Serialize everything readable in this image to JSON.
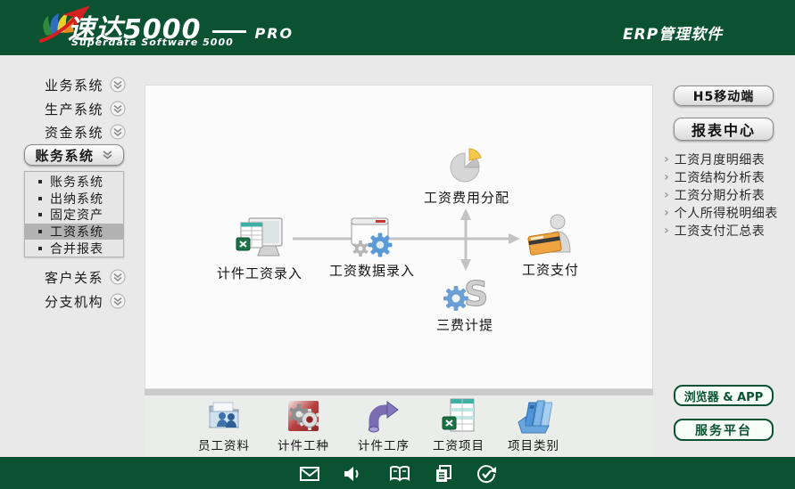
{
  "header": {
    "product_name": "速达5000",
    "edition": "PRO",
    "subtitle": "Superdata Software 5000",
    "tagline": "ERP管理软件"
  },
  "sidebar": {
    "items": [
      {
        "label": "业务系统"
      },
      {
        "label": "生产系统"
      },
      {
        "label": "资金系统"
      },
      {
        "label": "账务系统",
        "expanded": true
      },
      {
        "label": "客户关系"
      },
      {
        "label": "分支机构"
      }
    ],
    "submenu": {
      "items": [
        {
          "label": "账务系统",
          "active": false
        },
        {
          "label": "出纳系统",
          "active": false
        },
        {
          "label": "固定资产",
          "active": false
        },
        {
          "label": "工资系统",
          "active": true
        },
        {
          "label": "合并报表",
          "active": false
        }
      ]
    }
  },
  "workflow": {
    "nodes": [
      {
        "label": "计件工资录入",
        "icon": "excel-monitor-icon"
      },
      {
        "label": "工资数据录入",
        "icon": "form-gears-icon"
      },
      {
        "label": "工资支付",
        "icon": "card-person-icon"
      },
      {
        "label": "工资费用分配",
        "icon": "pie-chart-icon"
      },
      {
        "label": "三费计提",
        "icon": "gear-money-icon"
      }
    ]
  },
  "tools": {
    "items": [
      {
        "label": "员工资料",
        "icon": "employee-folder-icon"
      },
      {
        "label": "计件工种",
        "icon": "work-type-gears-icon"
      },
      {
        "label": "计件工序",
        "icon": "process-pipe-icon"
      },
      {
        "label": "工资项目",
        "icon": "salary-sheet-icon"
      },
      {
        "label": "项目类别",
        "icon": "category-books-icon"
      }
    ]
  },
  "right_panel": {
    "h5_button": "H5移动端",
    "report_center_button": "报表中心",
    "reports": [
      {
        "label": "工资月度明细表"
      },
      {
        "label": "工资结构分析表"
      },
      {
        "label": "工资分期分析表"
      },
      {
        "label": "个人所得税明细表"
      },
      {
        "label": "工资支付汇总表"
      }
    ],
    "link_chevron": "›",
    "browser_app_button": "浏览器 & APP",
    "service_button": "服务平台"
  },
  "statusbar": {
    "icons": [
      "mail-icon",
      "sound-icon",
      "help-book-icon",
      "copy-icon",
      "task-check-icon"
    ]
  },
  "colors": {
    "header_green": "#0a5232",
    "body_bg": "#e9e9e9",
    "canvas_bg": "#fbfbfb",
    "active_item_bg": "#b2b2b2",
    "arrow_gray": "#c3c3c3",
    "green_button_text": "#0a5232"
  }
}
